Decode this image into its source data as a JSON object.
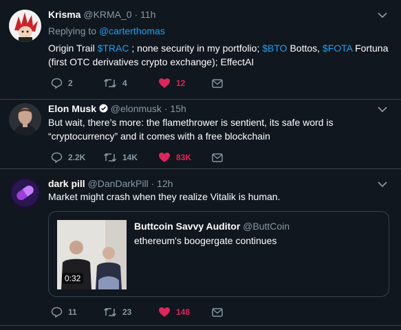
{
  "colors": {
    "background": "#10171e",
    "divider": "#38444d",
    "muted": "#8899a6",
    "link": "#1da1f2",
    "like": "#e0245e"
  },
  "tweets": [
    {
      "name": "Krisma",
      "handle": "@KRMA_0",
      "time": "11h",
      "replying_label": "Replying to",
      "replying_to": "@carterthomas",
      "text_parts": [
        "Origin Trail ",
        "$TRAC",
        " ; none security in my portfolio; ",
        "$BTO",
        " Bottos, ",
        "$FOTA",
        " Fortuna (first OTC derivatives crypto exchange); EffectAI"
      ],
      "replies": "2",
      "retweets": "4",
      "likes": "12",
      "avatar_icon": "anime-character-avatar"
    },
    {
      "name": "Elon Musk",
      "verified_icon": "verified-badge-icon",
      "handle": "@elonmusk",
      "time": "15h",
      "text": "But wait, there’s more: the flamethrower is sentient, its safe word is “cryptocurrency” and it comes with a free blockchain",
      "replies": "2.2K",
      "retweets": "14K",
      "likes": "83K",
      "avatar_icon": "person-photo-avatar"
    },
    {
      "name": "dark pill",
      "handle": "@DanDarkPill",
      "time": "12h",
      "text": "Market might crash when they realize Vitalik is human.",
      "quote": {
        "name": "Buttcoin Savvy Auditor",
        "handle": "@ButtCoin",
        "text": "ethereum's boogergate continues",
        "video_duration": "0:32"
      },
      "replies": "11",
      "retweets": "23",
      "likes": "148",
      "avatar_icon": "purple-pill-avatar"
    }
  ],
  "separator": "·"
}
